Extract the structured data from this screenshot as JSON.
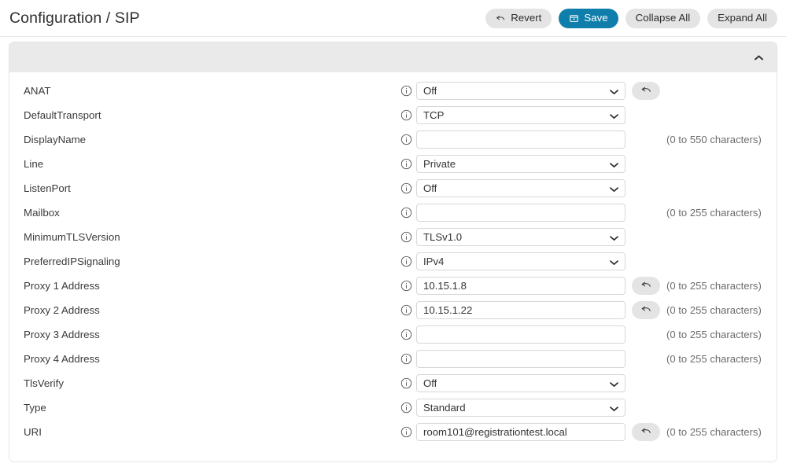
{
  "header": {
    "title": "Configuration / SIP",
    "actions": [
      {
        "label": "Revert",
        "icon": "undo-arrow-icon",
        "style": "default"
      },
      {
        "label": "Save",
        "icon": "save-disk-icon",
        "style": "primary"
      },
      {
        "label": "Collapse All",
        "icon": "",
        "style": "default"
      },
      {
        "label": "Expand All",
        "icon": "",
        "style": "default"
      }
    ]
  },
  "card": {
    "collapse_icon": "chevron-up-icon",
    "info_icon": "info-circle-icon",
    "revert_icon": "undo-arrow-icon",
    "select_caret_icon": "chevron-down-icon",
    "rows": [
      {
        "label": "ANAT",
        "control": "select",
        "value": "Off",
        "revert": true,
        "hint": ""
      },
      {
        "label": "DefaultTransport",
        "control": "select",
        "value": "TCP",
        "revert": false,
        "hint": ""
      },
      {
        "label": "DisplayName",
        "control": "input",
        "value": "",
        "revert": false,
        "hint": "(0 to 550 characters)"
      },
      {
        "label": "Line",
        "control": "select",
        "value": "Private",
        "revert": false,
        "hint": ""
      },
      {
        "label": "ListenPort",
        "control": "select",
        "value": "Off",
        "revert": false,
        "hint": ""
      },
      {
        "label": "Mailbox",
        "control": "input",
        "value": "",
        "revert": false,
        "hint": "(0 to 255 characters)"
      },
      {
        "label": "MinimumTLSVersion",
        "control": "select",
        "value": "TLSv1.0",
        "revert": false,
        "hint": ""
      },
      {
        "label": "PreferredIPSignaling",
        "control": "select",
        "value": "IPv4",
        "revert": false,
        "hint": ""
      },
      {
        "label": "Proxy 1 Address",
        "control": "input",
        "value": "10.15.1.8",
        "revert": true,
        "hint": "(0 to 255 characters)"
      },
      {
        "label": "Proxy 2 Address",
        "control": "input",
        "value": "10.15.1.22",
        "revert": true,
        "hint": "(0 to 255 characters)"
      },
      {
        "label": "Proxy 3 Address",
        "control": "input",
        "value": "",
        "revert": false,
        "hint": "(0 to 255 characters)"
      },
      {
        "label": "Proxy 4 Address",
        "control": "input",
        "value": "",
        "revert": false,
        "hint": "(0 to 255 characters)"
      },
      {
        "label": "TlsVerify",
        "control": "select",
        "value": "Off",
        "revert": false,
        "hint": ""
      },
      {
        "label": "Type",
        "control": "select",
        "value": "Standard",
        "revert": false,
        "hint": ""
      },
      {
        "label": "URI",
        "control": "input",
        "value": "room101@registrationtest.local",
        "revert": true,
        "hint": "(0 to 255 characters)"
      }
    ]
  },
  "colors": {
    "primary": "#0f7eab",
    "button_bg": "#e4e4e4",
    "panel_header_bg": "#eaeaea",
    "border": "#e3e3e3",
    "hint_text": "#6d6d6d"
  }
}
